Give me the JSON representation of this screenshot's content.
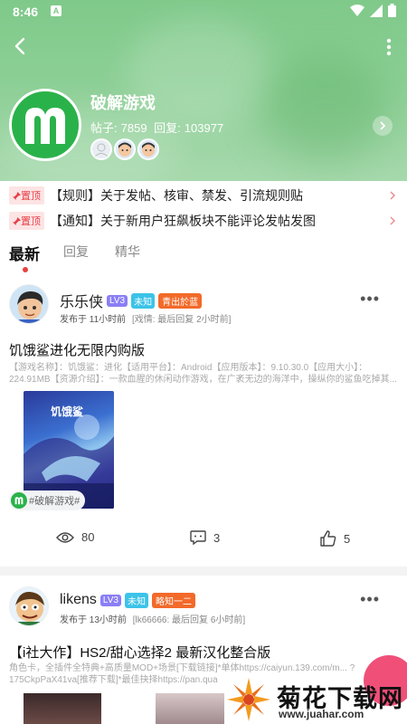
{
  "status_bar": {
    "time": "8:46",
    "notif_letter": "A"
  },
  "forum": {
    "name": "破解游戏",
    "posts_label": "帖子:",
    "posts_count": "7859",
    "replies_label": "回复:",
    "replies_count": "103977",
    "logo_letter": "m"
  },
  "pinned": [
    {
      "badge": "置顶",
      "text": "【规则】关于发帖、核审、禁发、引流规则贴"
    },
    {
      "badge": "置顶",
      "text": "【通知】关于新用户狂飙板块不能评论发帖发图"
    }
  ],
  "tabs": [
    "最新",
    "回复",
    "精华"
  ],
  "posts": [
    {
      "author": "乐乐侠",
      "level": "LV3",
      "status": "未知",
      "title_badge": "青出於蓝",
      "time": "发布于 11小时前",
      "last_reply": "[戏情: 最后回复 2小时前]",
      "title": "饥饿鲨进化无限内购版",
      "desc": "【游戏名称】：饥饿鲨：进化【适用平台】：Android【应用版本】：9.10.30.0【应用大小】：224.91MB【资源介绍】：一款血腥的休闲动作游戏，在广袤无边的海洋中，操纵你的鲨鱼吃掉其...",
      "image_caption": "饥饿鲨",
      "tag": "#破解游戏#",
      "views": "80",
      "comments": "3",
      "likes": "5"
    },
    {
      "author": "likens",
      "level": "LV3",
      "status": "未知",
      "title_badge": "略知一二",
      "time": "发布于 13小时前",
      "last_reply": "[lk66666: 最后回复 6小时前]",
      "title": "【i社大作】HS2/甜心选择2 最新汉化整合版",
      "desc": "角色卡，全插件全特典+高质量MOD+场景[下载链接]*单体https://caiyun.139.com/m... ?175CkpPaX41va[推荐下载]*最佳抉择https://pan.qua"
    }
  ],
  "watermark": {
    "title": "菊花下载网",
    "url": "www.juahar.com"
  }
}
